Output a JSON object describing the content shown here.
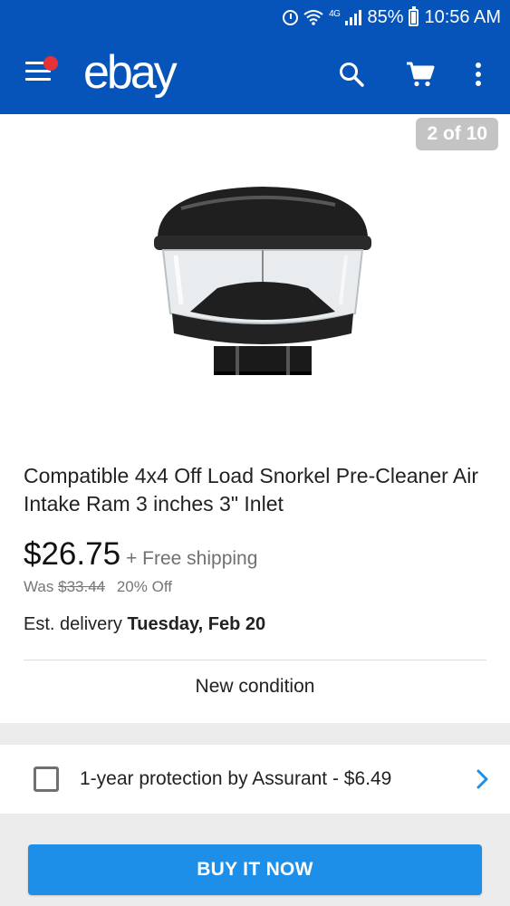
{
  "status_bar": {
    "network": "4G",
    "battery": "85%",
    "battery_level": 0.85,
    "time": "10:56 AM",
    "icons": [
      "alarm-icon",
      "wifi-icon",
      "signal-icon",
      "battery-icon"
    ]
  },
  "app_bar": {
    "logo": "ebay",
    "icons": [
      "menu-icon",
      "search-icon",
      "cart-icon",
      "more-vert-icon"
    ]
  },
  "gallery": {
    "counter": "2 of 10",
    "image": "air-intake-snorkel-pre-cleaner-image"
  },
  "product": {
    "title": "Compatible 4x4 Off Load Snorkel Pre-Cleaner Air Intake Ram 3 inches 3\" Inlet",
    "price": "$26.75",
    "shipping": "+ Free shipping",
    "was_label": "Was",
    "was_price": "$33.44",
    "discount": "20% Off",
    "delivery_prefix": "Est. delivery",
    "delivery_date": "Tuesday, Feb 20",
    "condition": "New condition"
  },
  "protection": {
    "label": "1-year protection by Assurant - $6.49",
    "checked": false
  },
  "actions": {
    "buy_now": "BUY IT NOW"
  },
  "colors": {
    "brand_blue": "#0654ba",
    "notif_red": "#e53238",
    "buy_button": "#1e8fe8",
    "chevron": "#1e8fe8"
  }
}
